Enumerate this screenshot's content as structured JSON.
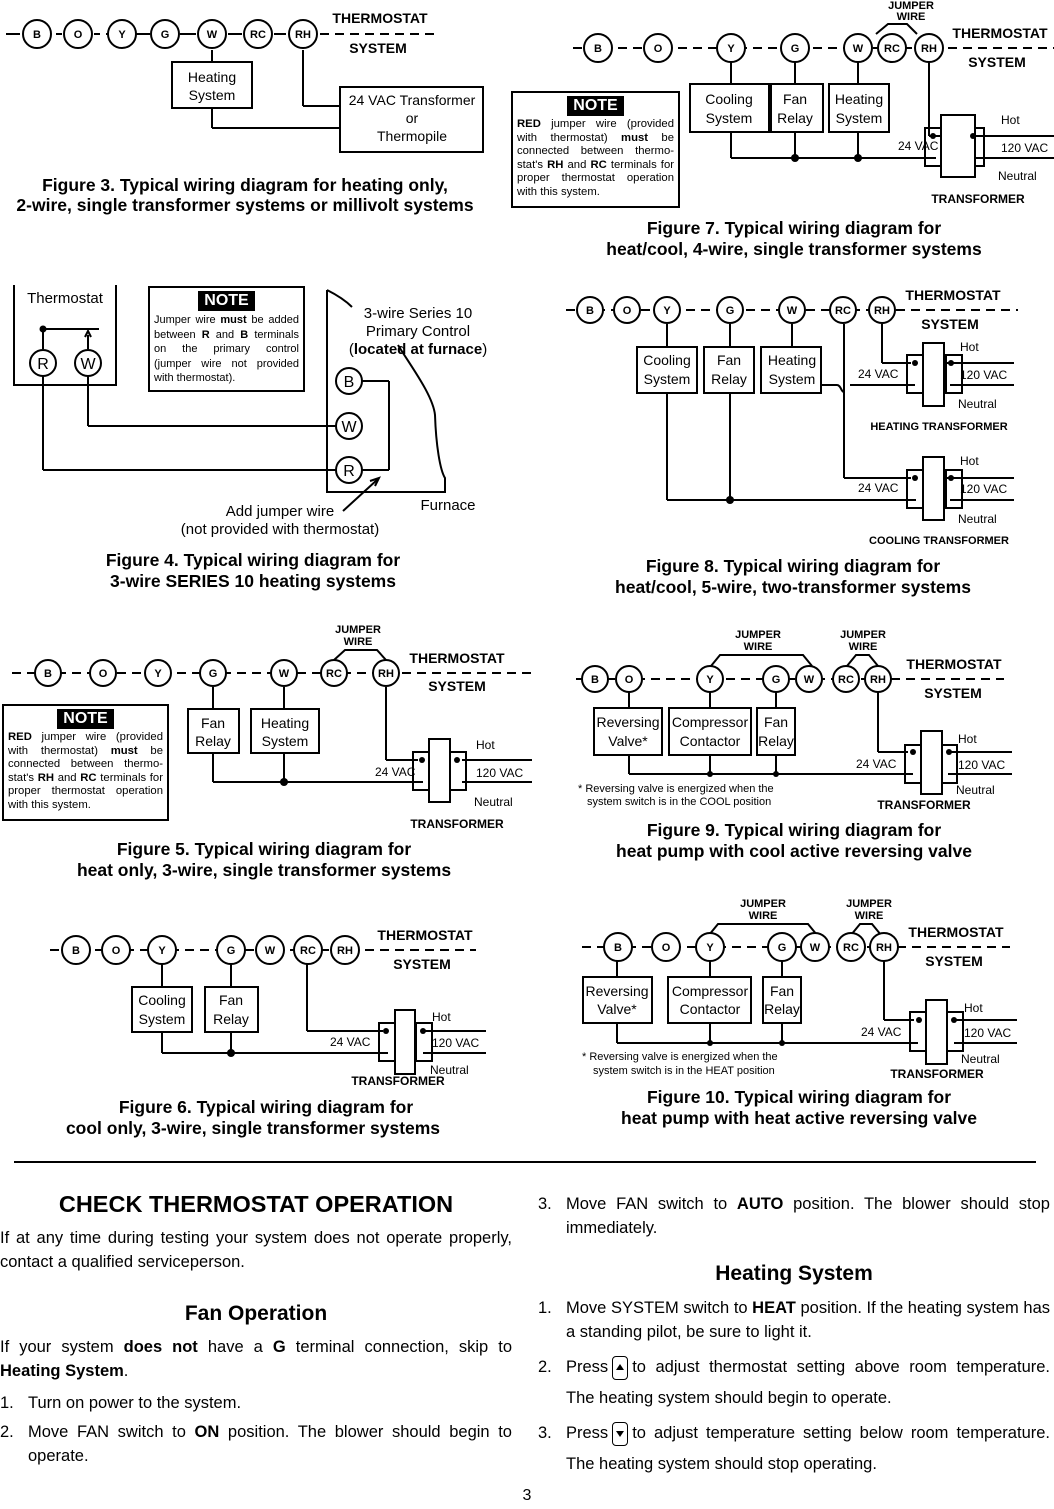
{
  "terminals": {
    "B": "B",
    "O": "O",
    "Y": "Y",
    "G": "G",
    "W": "W",
    "RC": "RC",
    "RH": "RH",
    "R": "R"
  },
  "common": {
    "thermostat": "THERMOSTAT",
    "system": "SYSTEM",
    "jumper_line1": "JUMPER",
    "jumper_line2": "WIRE",
    "transformer": "TRANSFORMER",
    "v24": "24 VAC",
    "v120": "120 VAC",
    "hot": "Hot",
    "neutral": "Neutral"
  },
  "devices": {
    "heating": [
      "Heating",
      "System"
    ],
    "cooling": [
      "Cooling",
      "System"
    ],
    "fan": [
      "Fan",
      "Relay"
    ],
    "reversing": [
      "Reversing",
      "Valve*"
    ],
    "compressor": [
      "Compressor",
      "Contactor"
    ],
    "transformer_or_thermopile": [
      "24 VAC Transformer",
      "or",
      "Thermopile"
    ]
  },
  "notes": {
    "tag": "NOTE",
    "red_jumper": {
      "bold1": "RED",
      "t1": " jumper wire (provided with thermostat) ",
      "bold2": "must",
      "t2": " be connected between thermo­stat's ",
      "bold3": "RH",
      "t3": " and ",
      "bold4": "RC",
      "t4": " terminals for proper thermostat oper­ation with this system."
    },
    "series10": {
      "t1": "Jumper wire ",
      "bold1": "must",
      "t2": " be added between ",
      "bold2": "R",
      "t3": " and ",
      "bold3": "B",
      "t4": " terminals on the primary control (jumper wire not provided with thermostat)."
    }
  },
  "figures": {
    "fig3": {
      "caption": [
        "Figure 3. Typical wiring diagram for heating only,",
        "2-wire, single transformer systems or millivolt systems"
      ]
    },
    "fig4": {
      "caption": [
        "Figure 4. Typical wiring diagram for",
        "3-wire SERIES 10 heating systems"
      ],
      "thermostat": "Thermostat",
      "control": [
        "3-wire Series 10",
        "Primary Control",
        "located at furnace"
      ],
      "furnace": "Furnace",
      "jumper": [
        "Add jumper wire",
        "(not provided with thermostat)"
      ]
    },
    "fig5": {
      "caption": [
        "Figure 5. Typical wiring diagram for",
        "heat only,  3-wire, single transformer systems"
      ]
    },
    "fig6": {
      "caption": [
        "Figure 6. Typical wiring diagram for",
        "cool only, 3-wire, single transformer systems"
      ]
    },
    "fig7": {
      "caption": [
        "Figure 7. Typical wiring diagram for",
        "heat/cool, 4-wire, single transformer systems"
      ]
    },
    "fig8": {
      "caption": [
        "Figure 8. Typical wiring diagram for",
        "heat/cool, 5-wire, two-transformer systems"
      ],
      "heating_transformer": "HEATING TRANSFORMER",
      "cooling_transformer": "COOLING TRANSFORMER"
    },
    "fig9": {
      "caption": [
        "Figure 9. Typical wiring diagram for",
        "heat pump with cool active reversing valve"
      ],
      "footnote": [
        "* Reversing valve is energized when the",
        "system switch is in the COOL position"
      ]
    },
    "fig10": {
      "caption": [
        "Figure 10. Typical wiring diagram for",
        "heat pump with heat active reversing valve"
      ],
      "footnote": [
        "* Reversing valve is energized when the",
        "system switch is in the HEAT position"
      ]
    }
  },
  "body": {
    "title": "CHECK THERMOSTAT OPERATION",
    "intro": "If at any time during testing your system does not operate properly, contact a qualified serviceperson.",
    "fan": {
      "heading": "Fan Operation",
      "p_t1": "If your system ",
      "p_b1": "does not",
      "p_t2": " have a ",
      "p_b2": "G",
      "p_t3": " terminal connection, skip to ",
      "p_b3": "Heating System",
      "p_t4": ".",
      "steps": [
        {
          "num": "1.",
          "t1": "Turn on power to the system."
        },
        {
          "num": "2.",
          "t1": "Move FAN switch to ",
          "b": "ON",
          "t2": " position. The blower should begin to operate."
        },
        {
          "num": "3.",
          "t1": "Move FAN switch to ",
          "b": "AUTO",
          "t2": " position. The blower should stop immediately."
        }
      ]
    },
    "heating": {
      "heading": "Heating System",
      "steps": [
        {
          "num": "1.",
          "t1": "Move SYSTEM switch to ",
          "b": "HEAT",
          "t2": " position. If the heating system has a standing pilot, be sure to light it."
        },
        {
          "num": "2.",
          "t1": "Press",
          "button": "up-arrow",
          "t2": "to adjust thermostat setting above room tempera­ture. The heating system should begin to operate."
        },
        {
          "num": "3.",
          "t1": "Press",
          "button": "down-arrow",
          "t2": "to adjust temperature setting below room tempera­ture. The heating system should stop operating."
        }
      ]
    }
  },
  "page_number": "3"
}
